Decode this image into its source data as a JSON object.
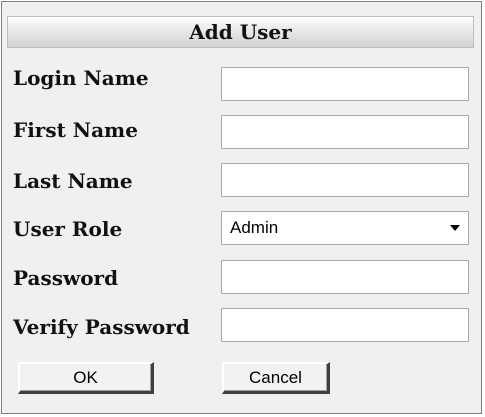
{
  "form": {
    "title": "Add User",
    "fields": {
      "login_name": {
        "label": "Login Name",
        "value": ""
      },
      "first_name": {
        "label": "First Name",
        "value": ""
      },
      "last_name": {
        "label": "Last Name",
        "value": ""
      },
      "user_role": {
        "label": "User Role",
        "value": "Admin"
      },
      "password": {
        "label": "Password",
        "value": ""
      },
      "verify_password": {
        "label": "Verify Password",
        "value": ""
      }
    },
    "buttons": {
      "ok_label": "OK",
      "cancel_label": "Cancel"
    }
  },
  "icons": {
    "role_dropdown": "chevron-down-icon"
  }
}
